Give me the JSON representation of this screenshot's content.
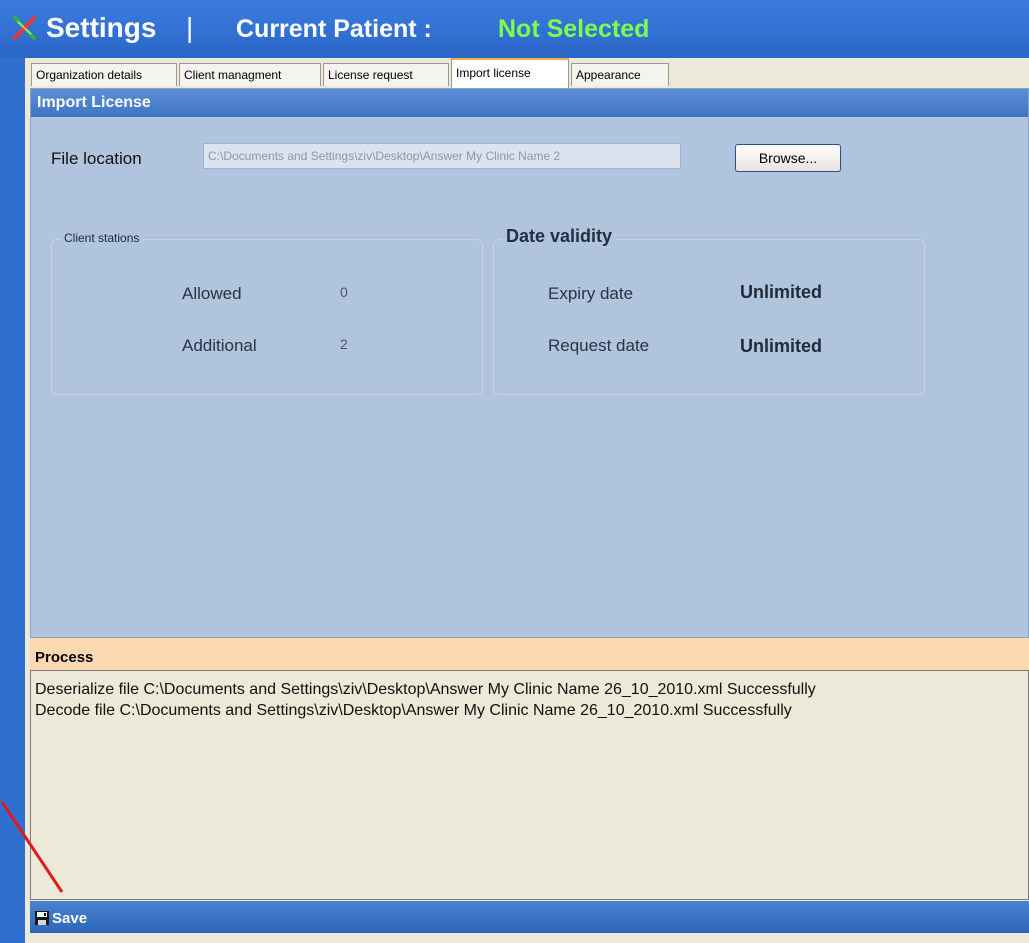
{
  "window": {
    "title": "Settings",
    "separator": "|",
    "patient_label": "Current Patient :",
    "patient_value": "Not Selected"
  },
  "tabs": [
    {
      "label": "Organization details",
      "active": false
    },
    {
      "label": "Client managment",
      "active": false
    },
    {
      "label": "License request",
      "active": false
    },
    {
      "label": "Import license",
      "active": true
    },
    {
      "label": "Appearance",
      "active": false
    }
  ],
  "import_license": {
    "header": "Import License",
    "file_location_label": "File location",
    "file_location_value": "C:\\Documents and Settings\\ziv\\Desktop\\Answer My Clinic Name 2",
    "browse_label": "Browse...",
    "client_stations": {
      "title": "Client stations",
      "allowed_label": "Allowed",
      "allowed_value": "0",
      "additional_label": "Additional",
      "additional_value": "2"
    },
    "date_validity": {
      "title": "Date validity",
      "expiry_label": "Expiry date",
      "expiry_value": "Unlimited",
      "request_label": "Request date",
      "request_value": "Unlimited"
    }
  },
  "process": {
    "header": "Process",
    "lines": [
      "Deserialize file C:\\Documents and Settings\\ziv\\Desktop\\Answer My Clinic Name 26_10_2010.xml Successfully",
      "Decode file  C:\\Documents and Settings\\ziv\\Desktop\\Answer My Clinic Name 26_10_2010.xml Successfully"
    ]
  },
  "toolbar": {
    "save_label": "Save"
  },
  "colors": {
    "title_bar": "#2e6fd0",
    "patient_value": "#7cff4e",
    "panel_bg": "#b0c4de",
    "process_header_bg": "#fbd9b0",
    "annotation_arrow": "#e01b1b"
  },
  "icons": {
    "app": "x-logo-icon",
    "save": "floppy-disk-icon"
  }
}
